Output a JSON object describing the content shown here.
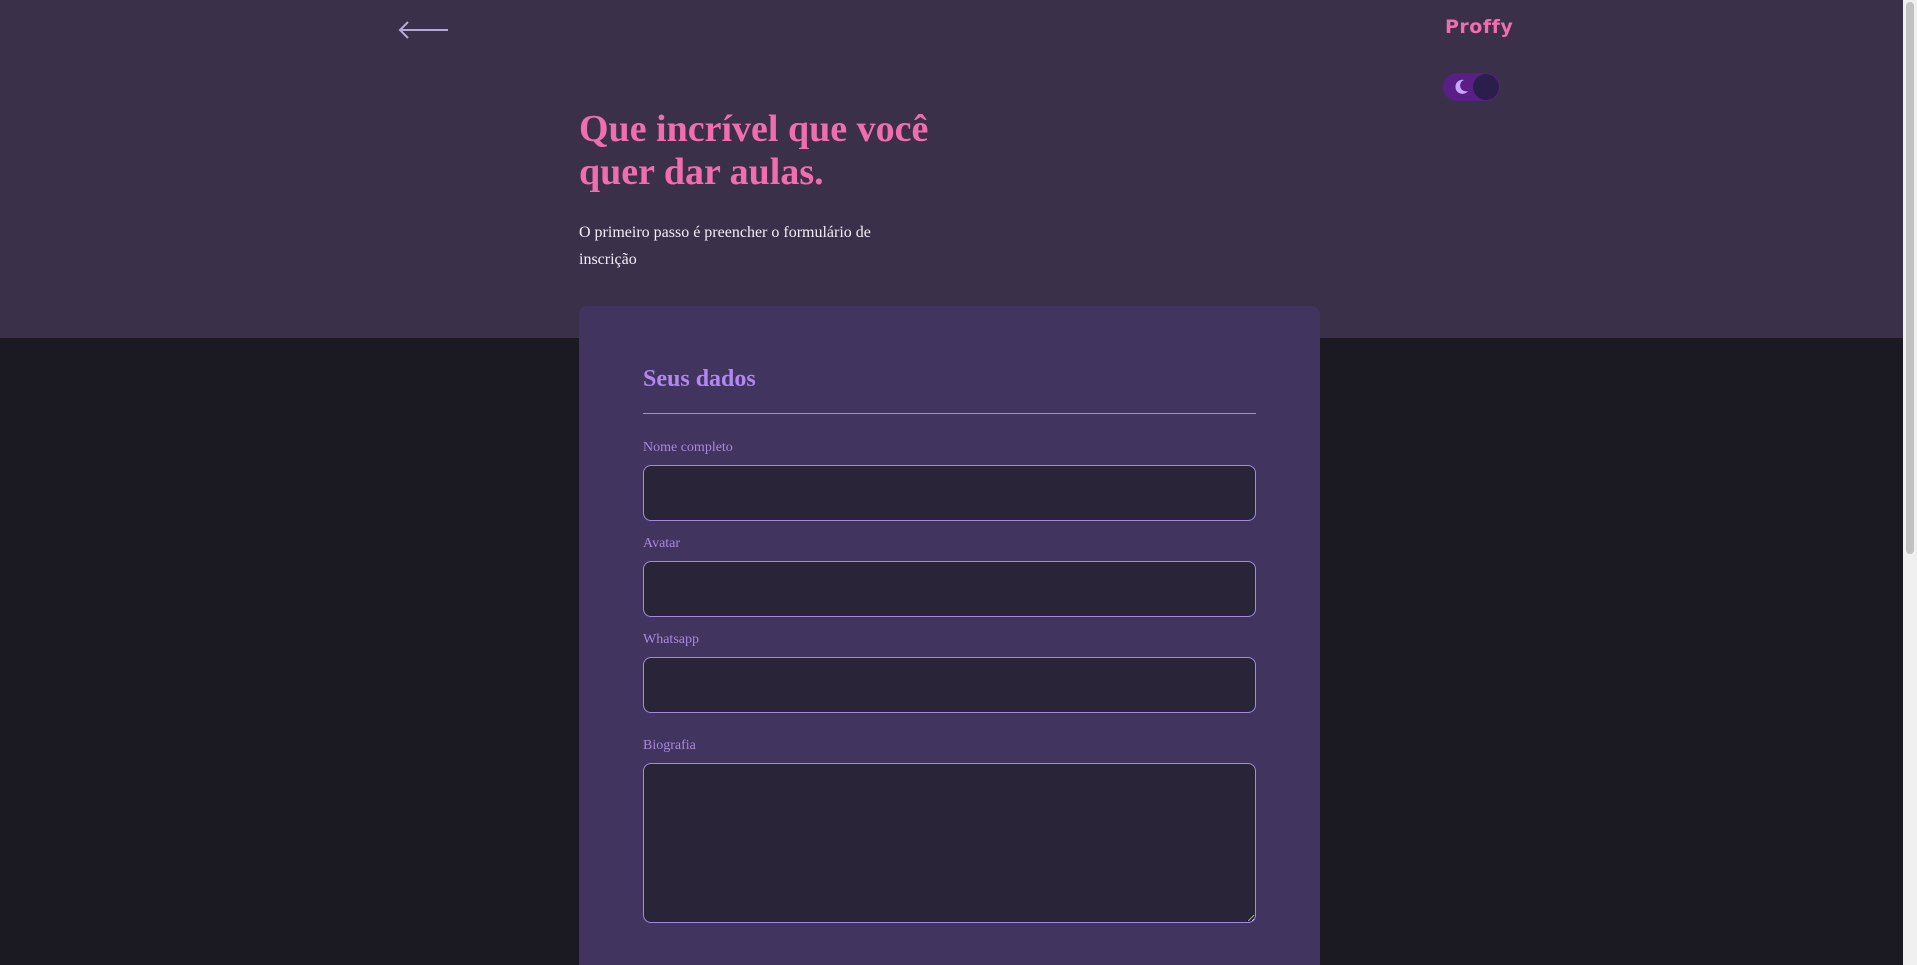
{
  "header": {
    "logo": "Proffy",
    "back_icon": "arrow-left-icon",
    "theme_toggle_icon": "moon-icon"
  },
  "hero": {
    "title_lines": [
      "Que incrível que você",
      "quer dar aulas."
    ],
    "subtitle_lines": [
      "O primeiro passo é preencher o formulário de",
      "inscrição"
    ]
  },
  "form": {
    "section_title": "Seus dados",
    "fields": [
      {
        "label": "Nome completo",
        "value": "",
        "placeholder": ""
      },
      {
        "label": "Avatar",
        "value": "",
        "placeholder": ""
      },
      {
        "label": "Whatsapp",
        "value": "",
        "placeholder": ""
      },
      {
        "label": "Biografia",
        "value": "",
        "placeholder": ""
      }
    ]
  },
  "colors": {
    "header_bg": "#3a3049",
    "page_bg": "#1b1a22",
    "card_bg": "#41345f",
    "accent_pink": "#f06db0",
    "accent_purple": "#b188ef",
    "input_bg": "#2a2438",
    "input_border": "#a38ae0"
  }
}
